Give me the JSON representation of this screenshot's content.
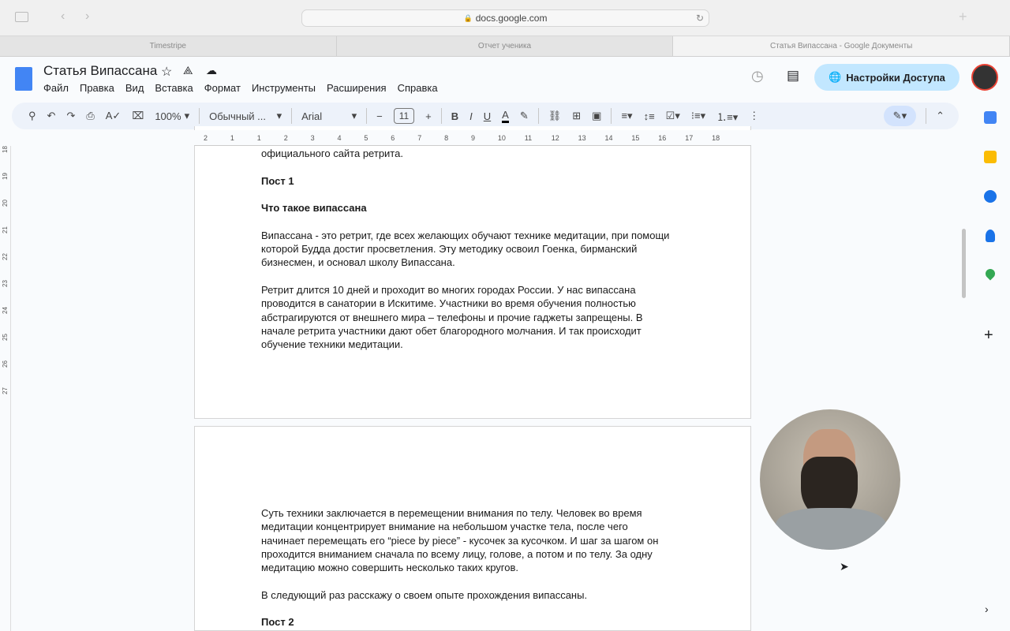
{
  "browser": {
    "url": "docs.google.com",
    "tabs": [
      {
        "label": "Timestripe"
      },
      {
        "label": "Отчет ученика"
      },
      {
        "label": "Статья Випассана - Google Документы"
      }
    ]
  },
  "doc": {
    "title": "Статья Випассана",
    "menu": [
      "Файл",
      "Правка",
      "Вид",
      "Вставка",
      "Формат",
      "Инструменты",
      "Расширения",
      "Справка"
    ],
    "share_label": "Настройки Доступа"
  },
  "toolbar": {
    "zoom": "100%",
    "style": "Обычный ...",
    "font": "Arial",
    "font_size": "11"
  },
  "ruler": {
    "ticks": [
      "2",
      "1",
      "1",
      "2",
      "3",
      "4",
      "5",
      "6",
      "7",
      "8",
      "9",
      "10",
      "11",
      "12",
      "13",
      "14",
      "15",
      "16",
      "17",
      "18"
    ],
    "vticks": [
      "18",
      "19",
      "20",
      "21",
      "22",
      "23",
      "24",
      "25",
      "26",
      "27"
    ]
  },
  "content": {
    "page1": [
      {
        "text": "официального сайта ретрита.",
        "bold": false
      },
      {
        "text": "Пост 1",
        "bold": true
      },
      {
        "text": "Что такое випассана",
        "bold": true
      },
      {
        "lines": [
          "Випассана - это ретрит, где всех желающих обучают технике медитации, при помощи",
          "которой Будда достиг просветления. Эту методику освоил Гоенка, бирманский",
          "бизнесмен, и основал школу Випассана."
        ]
      },
      {
        "lines": [
          "Ретрит длится 10 дней и проходит во многих городах России. У нас випассана",
          "проводится в санатории в Искитиме. Участники во время обучения полностью",
          "абстрагируются от внешнего мира – телефоны и прочие гаджеты запрещены. В",
          "начале ретрита участники дают обет благородного молчания. И так происходит",
          "обучение техники медитации."
        ]
      }
    ],
    "page2": [
      {
        "lines": [
          "Суть техники заключается в перемещении внимания по телу. Человек во время",
          "медитации концентрирует внимание на небольшом участке тела, после чего",
          "начинает перемещать его “piece by piece” - кусочек за кусочком. И шаг за шагом он",
          "проходится вниманием сначала по всему лицу, голове, а потом и по телу. За одну",
          "медитацию можно совершить несколько таких кругов."
        ]
      },
      {
        "text": "В следующий раз расскажу о своем опыте прохождения випассаны.",
        "bold": false
      },
      {
        "text": "Пост 2",
        "bold": true
      }
    ]
  },
  "colors": {
    "accent": "#1a73e8",
    "share_bg": "#c2e7ff",
    "toolbar_bg": "#edf2fa"
  }
}
